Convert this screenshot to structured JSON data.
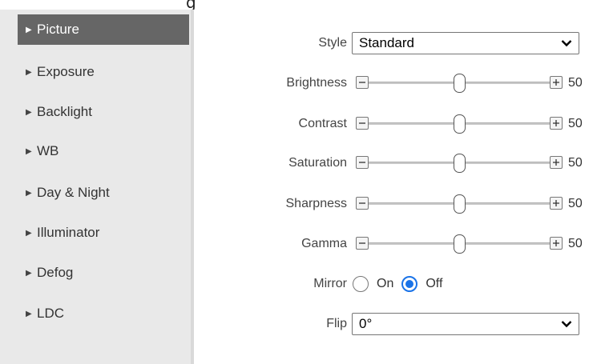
{
  "header": {
    "cut_text": "g"
  },
  "sidebar": {
    "items": [
      {
        "label": "Picture",
        "active": true
      },
      {
        "label": "Exposure",
        "active": false
      },
      {
        "label": "Backlight",
        "active": false
      },
      {
        "label": "WB",
        "active": false
      },
      {
        "label": "Day & Night",
        "active": false
      },
      {
        "label": "Illuminator",
        "active": false
      },
      {
        "label": "Defog",
        "active": false
      },
      {
        "label": "LDC",
        "active": false
      }
    ]
  },
  "form": {
    "style": {
      "label": "Style",
      "value": "Standard"
    },
    "sliders": [
      {
        "label": "Brightness",
        "value": "50",
        "level": 0.5
      },
      {
        "label": "Contrast",
        "value": "50",
        "level": 0.5
      },
      {
        "label": "Saturation",
        "value": "50",
        "level": 0.5
      },
      {
        "label": "Sharpness",
        "value": "50",
        "level": 0.5
      },
      {
        "label": "Gamma",
        "value": "50",
        "level": 0.5
      }
    ],
    "mirror": {
      "label": "Mirror",
      "options": [
        "On",
        "Off"
      ],
      "selected": "Off"
    },
    "flip": {
      "label": "Flip",
      "value": "0°"
    }
  },
  "colors": {
    "accent": "#1a73e8",
    "active_menu_bg": "#666666",
    "sidebar_bg": "#e9e9e9"
  }
}
